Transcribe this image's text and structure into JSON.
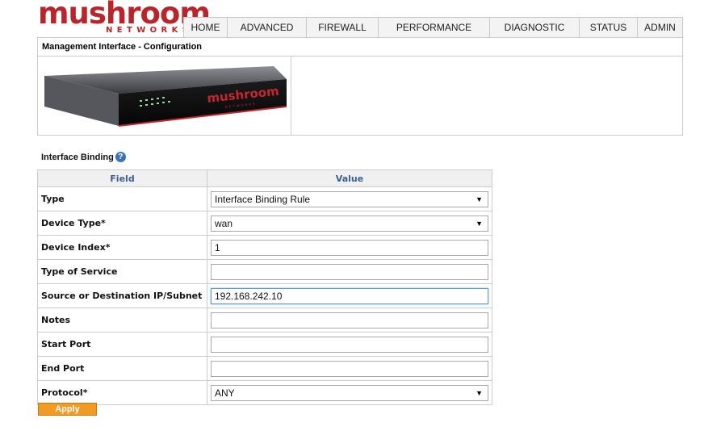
{
  "brand": {
    "name": "mushroom",
    "sub": "NETWORKS",
    "color": "#b8262c"
  },
  "nav": [
    {
      "label": "HOME"
    },
    {
      "label": "ADVANCED"
    },
    {
      "label": "FIREWALL"
    },
    {
      "label": "PERFORMANCE"
    },
    {
      "label": "DIAGNOSTIC"
    },
    {
      "label": "STATUS"
    },
    {
      "label": "ADMIN"
    }
  ],
  "panel": {
    "title": "Management Interface - Configuration"
  },
  "device": {
    "brand_text": "mushroom",
    "sub_text": "NETWORKS"
  },
  "section": {
    "title": "Interface Binding",
    "help_icon": "question-circle-icon"
  },
  "table": {
    "headers": {
      "field": "Field",
      "value": "Value"
    },
    "rows": [
      {
        "label": "Type",
        "value": "Interface Binding Rule"
      },
      {
        "label": "Device Type*",
        "value": "wan"
      },
      {
        "label": "Device Index*",
        "value": "1"
      },
      {
        "label": "Type of Service",
        "value": ""
      },
      {
        "label": "Source or Destination IP/Subnet",
        "value": "192.168.242.10"
      },
      {
        "label": "Notes",
        "value": ""
      },
      {
        "label": "Start Port",
        "value": ""
      },
      {
        "label": "End Port",
        "value": ""
      },
      {
        "label": "Protocol*",
        "value": "ANY"
      }
    ]
  },
  "actions": {
    "apply_label": "Apply"
  },
  "colors": {
    "accent": "#f39a23",
    "header_text": "#3b5e93",
    "help_icon": "#3d72b8"
  }
}
